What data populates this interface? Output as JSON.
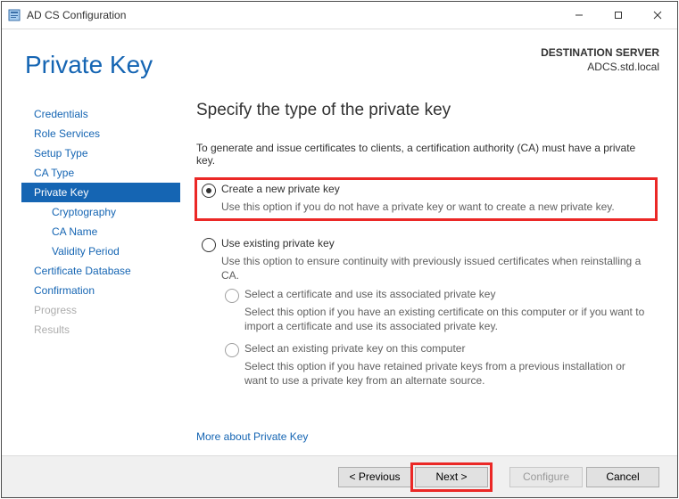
{
  "window": {
    "title": "AD CS Configuration"
  },
  "header": {
    "title": "Private Key",
    "dest_label": "DESTINATION SERVER",
    "dest_value": "ADCS.std.local"
  },
  "sidebar": {
    "items": [
      {
        "label": "Credentials"
      },
      {
        "label": "Role Services"
      },
      {
        "label": "Setup Type"
      },
      {
        "label": "CA Type"
      },
      {
        "label": "Private Key"
      },
      {
        "label": "Cryptography"
      },
      {
        "label": "CA Name"
      },
      {
        "label": "Validity Period"
      },
      {
        "label": "Certificate Database"
      },
      {
        "label": "Confirmation"
      },
      {
        "label": "Progress"
      },
      {
        "label": "Results"
      }
    ]
  },
  "main": {
    "heading": "Specify the type of the private key",
    "intro": "To generate and issue certificates to clients, a certification authority (CA) must have a private key.",
    "opt1": {
      "label": "Create a new private key",
      "desc": "Use this option if you do not have a private key or want to create a new private key."
    },
    "opt2": {
      "label": "Use existing private key",
      "desc": "Use this option to ensure continuity with previously issued certificates when reinstalling a CA.",
      "sub1": {
        "label": "Select a certificate and use its associated private key",
        "desc": "Select this option if you have an existing certificate on this computer or if you want to import a certificate and use its associated private key."
      },
      "sub2": {
        "label": "Select an existing private key on this computer",
        "desc": "Select this option if you have retained private keys from a previous installation or want to use a private key from an alternate source."
      }
    },
    "more_link": "More about Private Key"
  },
  "footer": {
    "previous": "< Previous",
    "next": "Next >",
    "configure": "Configure",
    "cancel": "Cancel"
  }
}
